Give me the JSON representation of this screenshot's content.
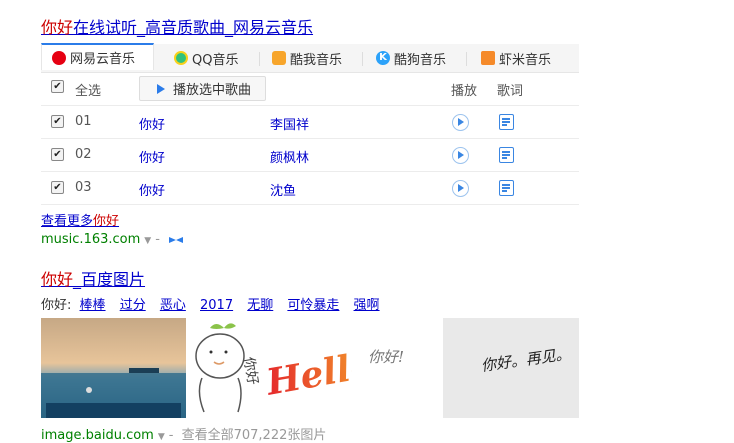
{
  "result1": {
    "title_highlight": "你好",
    "title_rest": "在线试听_高音质歌曲_网易云音乐",
    "tabs": [
      {
        "label": "网易云音乐",
        "icon": "netease-music-icon",
        "color": "#e60012"
      },
      {
        "label": "QQ音乐",
        "icon": "qq-music-icon",
        "color": "#31c27c"
      },
      {
        "label": "酷我音乐",
        "icon": "kuwo-music-icon",
        "color": "#f7a52b"
      },
      {
        "label": "酷狗音乐",
        "icon": "kugou-music-icon",
        "color": "#2ca2f9"
      },
      {
        "label": "虾米音乐",
        "icon": "xiami-music-icon",
        "color": "#f58a2a"
      }
    ],
    "header": {
      "select_all": "全选",
      "play_selected": "播放选中歌曲",
      "play": "播放",
      "lyrics": "歌词"
    },
    "songs": [
      {
        "num": "01",
        "title": "你好",
        "artist": "李国祥"
      },
      {
        "num": "02",
        "title": "你好",
        "artist": "颜枫林"
      },
      {
        "num": "03",
        "title": "你好",
        "artist": "沈鱼"
      }
    ],
    "more_prefix": "查看更多",
    "more_highlight": "你好",
    "url": "music.163.com",
    "url_sep": "-"
  },
  "result2": {
    "title_highlight": "你好",
    "title_rest": "_百度图片",
    "tags_prefix": "你好:",
    "tags": [
      "棒棒",
      "过分",
      "恶心",
      "2017",
      "无聊",
      "可怜暴走",
      "强啊"
    ],
    "image_texts": [
      "你好",
      "Hello",
      "你好!",
      "你好。再见。"
    ],
    "url": "image.baidu.com",
    "url_sep": "-",
    "url_extra": "查看全部707,222张图片"
  },
  "colors": {
    "link": "#0000cc",
    "highlight": "#cc0000",
    "url": "#008000",
    "accent": "#2b7ce9"
  }
}
